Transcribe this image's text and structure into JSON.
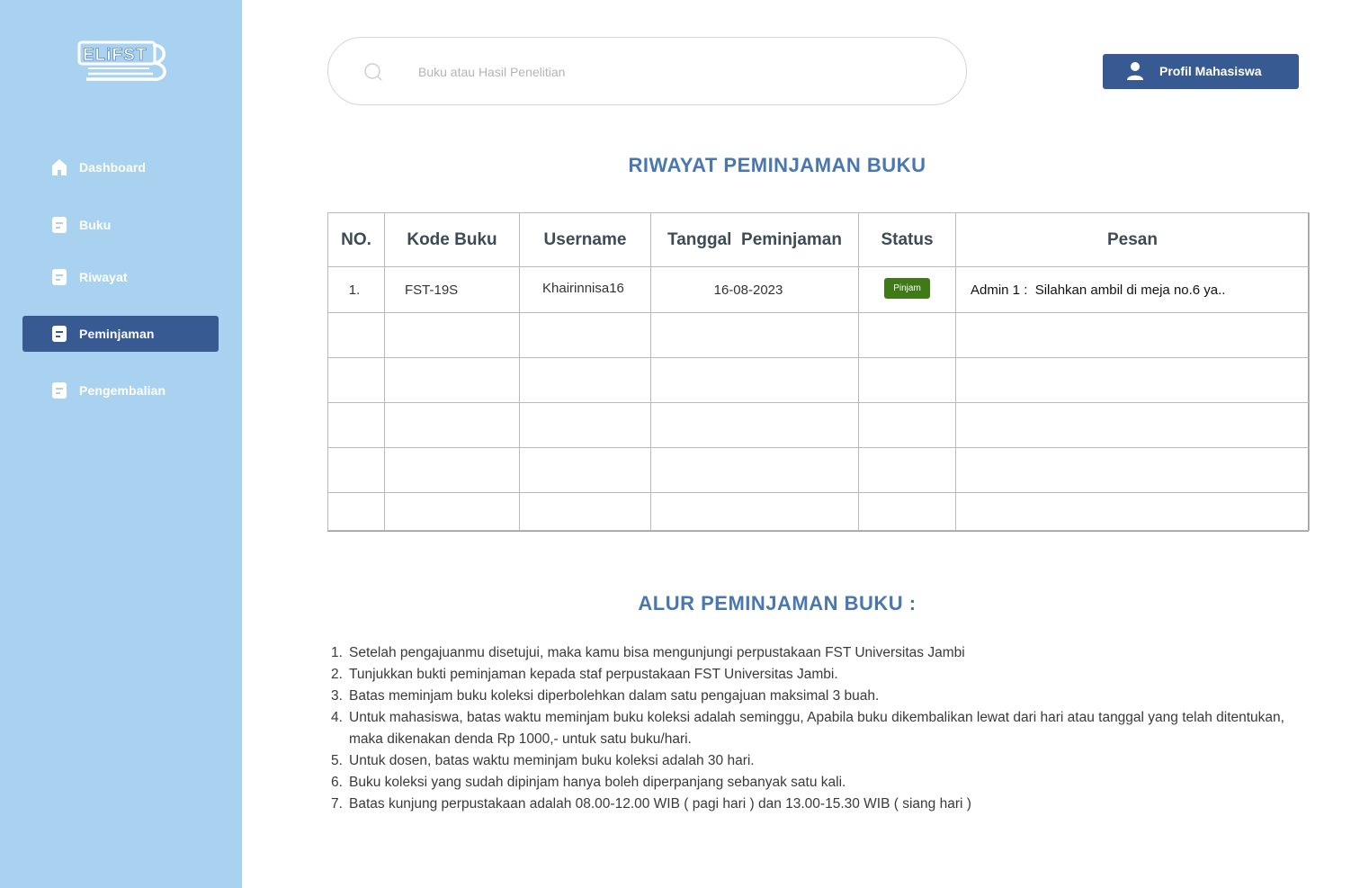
{
  "sidebar": {
    "logo_text": "ELIFSTB",
    "items": [
      {
        "label": "Dashboard",
        "icon": "home-icon",
        "active": false
      },
      {
        "label": "Buku",
        "icon": "document-icon",
        "active": false
      },
      {
        "label": "Riwayat",
        "icon": "document-icon",
        "active": false
      },
      {
        "label": "Peminjaman",
        "icon": "document-icon",
        "active": true
      },
      {
        "label": "Pengembalian",
        "icon": "document-icon",
        "active": false
      }
    ]
  },
  "search": {
    "placeholder": "Buku atau Hasil Penelitian",
    "value": "",
    "icon": "search-icon"
  },
  "profile_button": {
    "label": "Profil Mahasiswa",
    "icon": "user-icon"
  },
  "history": {
    "title": "RIWAYAT PEMINJAMAN BUKU",
    "columns": [
      "NO.",
      "Kode Buku",
      "Username",
      "Tanggal  Peminjaman",
      "Status",
      "Pesan"
    ],
    "rows": [
      {
        "no": "1.",
        "kode": "FST-19S",
        "username": "Khairinnisa16",
        "tanggal": "16-08-2023",
        "status": "Pinjam",
        "pesan": "Admin 1 :  Silahkan ambil di meja no.6 ya.."
      }
    ],
    "status_color": "#3f7a17"
  },
  "flow": {
    "title": "ALUR PEMINJAMAN BUKU :",
    "steps": [
      {
        "num": "1.",
        "text": "Setelah pengajuanmu disetujui, maka kamu bisa mengunjungi perpustakaan FST Universitas Jambi"
      },
      {
        "num": "2.",
        "text": "Tunjukkan bukti peminjaman kepada staf perpustakaan FST Universitas Jambi."
      },
      {
        "num": "3.",
        "text": "Batas meminjam buku koleksi diperbolehkan dalam satu pengajuan maksimal 3 buah."
      },
      {
        "num": "4.",
        "text": "Untuk mahasiswa, batas waktu meminjam buku koleksi adalah seminggu, Apabila buku dikembalikan lewat dari hari atau tanggal yang telah ditentukan, maka dikenakan denda Rp 1000,- untuk satu buku/hari."
      },
      {
        "num": "5.",
        "text": "Untuk dosen, batas waktu meminjam buku koleksi adalah 30 hari."
      },
      {
        "num": "6.",
        "text": "Buku koleksi yang sudah dipinjam hanya boleh diperpanjang sebanyak satu kali."
      },
      {
        "num": "7.",
        "text": "Batas kunjung perpustakaan adalah 08.00-12.00 WIB ( pagi hari ) dan 13.00-15.30 WIB ( siang hari )"
      }
    ]
  },
  "colors": {
    "sidebar_bg": "#a9d2f0",
    "accent": "#385a92",
    "title": "#4a77b0"
  }
}
